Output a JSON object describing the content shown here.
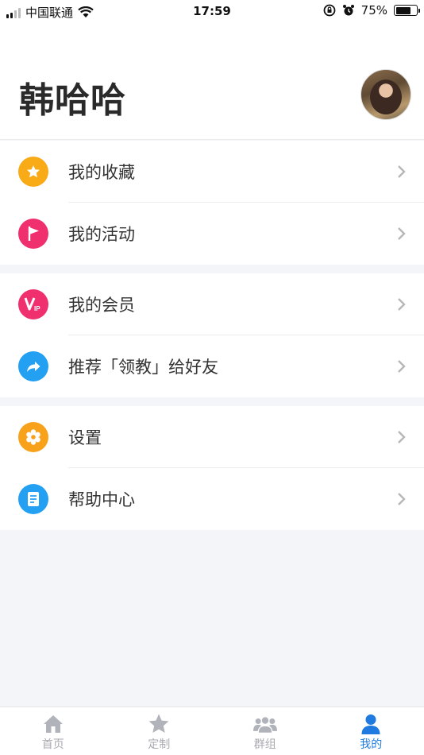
{
  "status_bar": {
    "carrier": "中国联通",
    "time": "17:59",
    "battery": "75%",
    "battery_level": 0.75
  },
  "profile": {
    "name": "韩哈哈"
  },
  "menu": {
    "group1": [
      {
        "label": "我的收藏",
        "icon": "star-icon",
        "color": "#f8ab16"
      },
      {
        "label": "我的活动",
        "icon": "flag-icon",
        "color": "#f0306e"
      }
    ],
    "group2": [
      {
        "label": "我的会员",
        "icon": "vip-icon",
        "color": "#f0306e"
      },
      {
        "label": "推荐「领教」给好友",
        "icon": "share-icon",
        "color": "#23a0f2"
      }
    ],
    "group3": [
      {
        "label": "设置",
        "icon": "gear-icon",
        "color": "#f8a21c"
      },
      {
        "label": "帮助中心",
        "icon": "document-icon",
        "color": "#23a0f2"
      }
    ]
  },
  "tabs": [
    {
      "label": "首页",
      "icon": "home-icon",
      "active": false
    },
    {
      "label": "定制",
      "icon": "star-icon",
      "active": false
    },
    {
      "label": "群组",
      "icon": "group-icon",
      "active": false
    },
    {
      "label": "我的",
      "icon": "person-icon",
      "active": true
    }
  ],
  "colors": {
    "accent": "#1f7be0",
    "inactive_tab": "#a8aab0",
    "background": "#f4f5f9"
  }
}
